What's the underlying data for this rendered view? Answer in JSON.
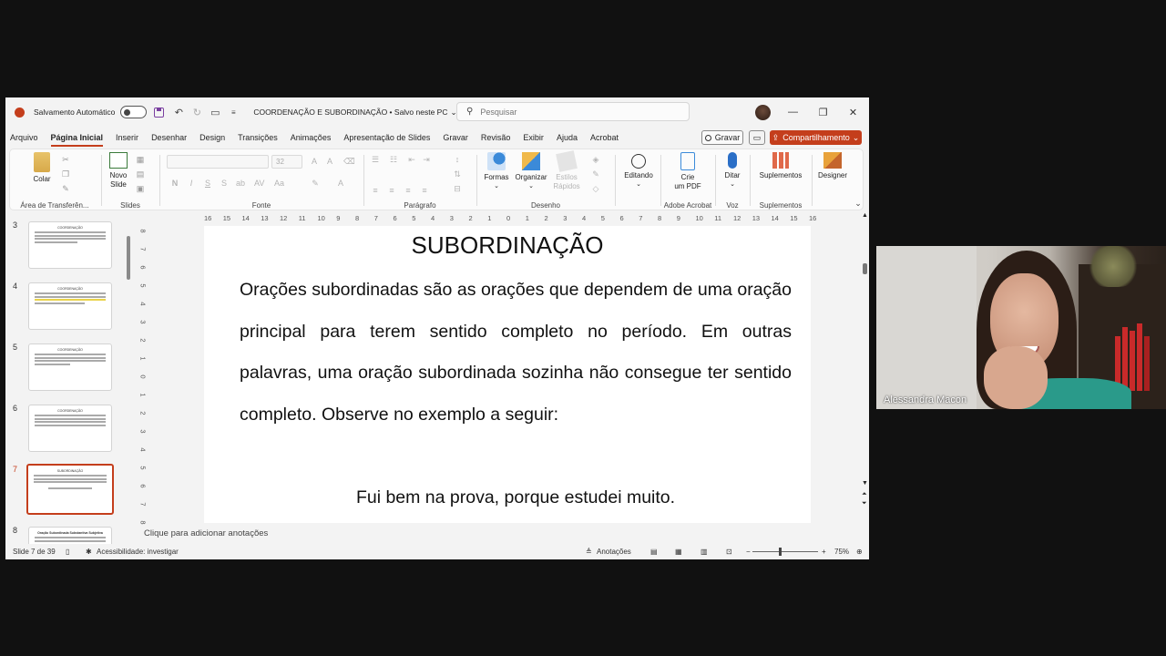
{
  "titlebar": {
    "autosave_label": "Salvamento Automático",
    "doc_title": "COORDENAÇÃO E SUBORDINAÇÃO • Salvo neste PC",
    "search_placeholder": "Pesquisar"
  },
  "menu": {
    "items": [
      "Arquivo",
      "Página Inicial",
      "Inserir",
      "Desenhar",
      "Design",
      "Transições",
      "Animações",
      "Apresentação de Slides",
      "Gravar",
      "Revisão",
      "Exibir",
      "Ajuda",
      "Acrobat"
    ],
    "active": "Página Inicial",
    "gravar": "Gravar",
    "share": "Compartilhamento"
  },
  "ribbon": {
    "colar": "Colar",
    "novo_slide_1": "Novo",
    "novo_slide_2": "Slide",
    "font_size": "32",
    "formas": "Formas",
    "organizar": "Organizar",
    "estilos_1": "Estilos",
    "estilos_2": "Rápidos",
    "editando": "Editando",
    "crie_pdf_1": "Crie",
    "crie_pdf_2": "um PDF",
    "ditar": "Ditar",
    "suplementos": "Suplementos",
    "designer": "Designer",
    "groups": {
      "clipboard": "Área de Transferên...",
      "slides": "Slides",
      "fonte": "Fonte",
      "paragrafo": "Parágrafo",
      "desenho": "Desenho",
      "adobe": "Adobe Acrobat",
      "voz": "Voz",
      "suplementos": "Suplementos"
    }
  },
  "thumbnails": [
    {
      "num": "3",
      "title": "COORDENAÇÃO"
    },
    {
      "num": "4",
      "title": "COORDENAÇÃO"
    },
    {
      "num": "5",
      "title": "COORDENAÇÃO"
    },
    {
      "num": "6",
      "title": "COORDENAÇÃO"
    },
    {
      "num": "7",
      "title": "SUBORDINAÇÃO"
    },
    {
      "num": "8",
      "title": "Oração Subordinada Substantiva Subjetiva"
    }
  ],
  "ruler": {
    "h": [
      "16",
      "15",
      "14",
      "13",
      "12",
      "11",
      "10",
      "9",
      "8",
      "7",
      "6",
      "5",
      "4",
      "3",
      "2",
      "1",
      "0",
      "1",
      "2",
      "3",
      "4",
      "5",
      "6",
      "7",
      "8",
      "9",
      "10",
      "11",
      "12",
      "13",
      "14",
      "15",
      "16"
    ],
    "v": [
      "8",
      "7",
      "6",
      "5",
      "4",
      "3",
      "2",
      "1",
      "0",
      "1",
      "2",
      "3",
      "4",
      "5",
      "6",
      "7",
      "8"
    ]
  },
  "slide": {
    "title": "SUBORDINAÇÃO",
    "body": "Orações subordinadas são as orações que dependem de uma oração principal para terem sentido completo no período. Em outras palavras, uma oração subordinada sozinha não consegue ter sentido completo. Observe no exemplo a seguir:",
    "example": "Fui bem na prova, porque estudei muito."
  },
  "notes_placeholder": "Clique para adicionar anotações",
  "status": {
    "slide_count": "Slide 7 de 39",
    "accessibility": "Acessibilidade: investigar",
    "notes": "Anotações",
    "zoom": "75%"
  },
  "webcam": {
    "name": "Alessandra Macon"
  }
}
